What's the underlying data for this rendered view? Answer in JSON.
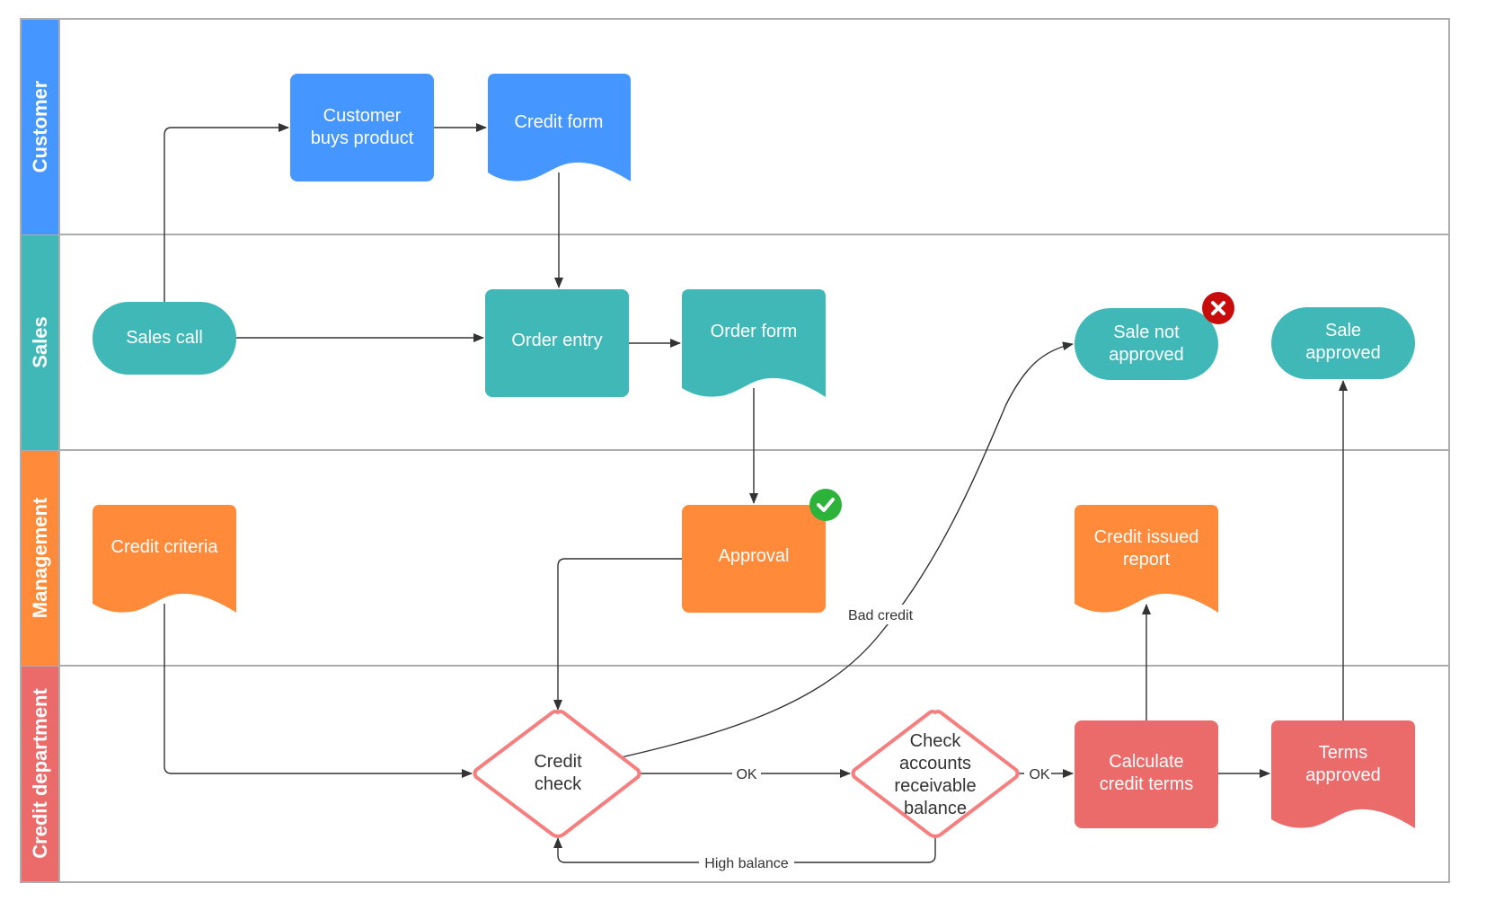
{
  "diagram": {
    "type": "swimlane-flowchart",
    "colors": {
      "customer": "#4596FF",
      "sales": "#40B8B8",
      "management": "#FF8A3A",
      "credit": "#EB6B6B",
      "decision_stroke": "#F67E7E",
      "success_badge": "#2EB33A",
      "error_badge": "#C80C0C",
      "border": "#ADADAD",
      "edge": "#333333"
    },
    "lanes": [
      {
        "id": "customer",
        "label": "Customer"
      },
      {
        "id": "sales",
        "label": "Sales"
      },
      {
        "id": "management",
        "label": "Management"
      },
      {
        "id": "credit",
        "label": "Credit department"
      }
    ],
    "nodes": {
      "customer_buys": {
        "lines": [
          "Customer",
          "buys product"
        ],
        "shape": "process",
        "lane": "customer"
      },
      "credit_form": {
        "lines": [
          "Credit form"
        ],
        "shape": "document",
        "lane": "customer"
      },
      "sales_call": {
        "lines": [
          "Sales call"
        ],
        "shape": "terminator",
        "lane": "sales"
      },
      "order_entry": {
        "lines": [
          "Order entry"
        ],
        "shape": "process",
        "lane": "sales"
      },
      "order_form": {
        "lines": [
          "Order form"
        ],
        "shape": "document",
        "lane": "sales"
      },
      "sale_not_approved": {
        "lines": [
          "Sale not",
          "approved"
        ],
        "shape": "terminator",
        "lane": "sales",
        "badge": "error"
      },
      "sale_approved": {
        "lines": [
          "Sale",
          "approved"
        ],
        "shape": "terminator",
        "lane": "sales"
      },
      "credit_criteria": {
        "lines": [
          "Credit criteria"
        ],
        "shape": "document",
        "lane": "management"
      },
      "approval": {
        "lines": [
          "Approval"
        ],
        "shape": "process",
        "lane": "management",
        "badge": "success"
      },
      "credit_issued_report": {
        "lines": [
          "Credit issued",
          "report"
        ],
        "shape": "document",
        "lane": "management"
      },
      "credit_check": {
        "lines": [
          "Credit",
          "check"
        ],
        "shape": "decision",
        "lane": "credit"
      },
      "check_accounts": {
        "lines": [
          "Check",
          "accounts",
          "receivable",
          "balance"
        ],
        "shape": "decision",
        "lane": "credit"
      },
      "calculate_terms": {
        "lines": [
          "Calculate",
          "credit terms"
        ],
        "shape": "process",
        "lane": "credit"
      },
      "terms_approved": {
        "lines": [
          "Terms",
          "approved"
        ],
        "shape": "document",
        "lane": "credit"
      }
    },
    "edges": [
      {
        "from": "sales_call",
        "to": "customer_buys",
        "label": ""
      },
      {
        "from": "customer_buys",
        "to": "credit_form",
        "label": ""
      },
      {
        "from": "credit_form",
        "to": "order_entry",
        "label": ""
      },
      {
        "from": "sales_call",
        "to": "order_entry",
        "label": ""
      },
      {
        "from": "order_entry",
        "to": "order_form",
        "label": ""
      },
      {
        "from": "order_form",
        "to": "approval",
        "label": ""
      },
      {
        "from": "approval",
        "to": "credit_check",
        "label": ""
      },
      {
        "from": "credit_criteria",
        "to": "credit_check",
        "label": ""
      },
      {
        "from": "credit_check",
        "to": "check_accounts",
        "label": "OK"
      },
      {
        "from": "credit_check",
        "to": "sale_not_approved",
        "label": "Bad credit"
      },
      {
        "from": "check_accounts",
        "to": "credit_check",
        "label": "High balance"
      },
      {
        "from": "check_accounts",
        "to": "calculate_terms",
        "label": "OK"
      },
      {
        "from": "calculate_terms",
        "to": "credit_issued_report",
        "label": ""
      },
      {
        "from": "calculate_terms",
        "to": "terms_approved",
        "label": ""
      },
      {
        "from": "terms_approved",
        "to": "sale_approved",
        "label": ""
      }
    ],
    "badges": {
      "success": "check-icon",
      "error": "x-icon"
    }
  }
}
